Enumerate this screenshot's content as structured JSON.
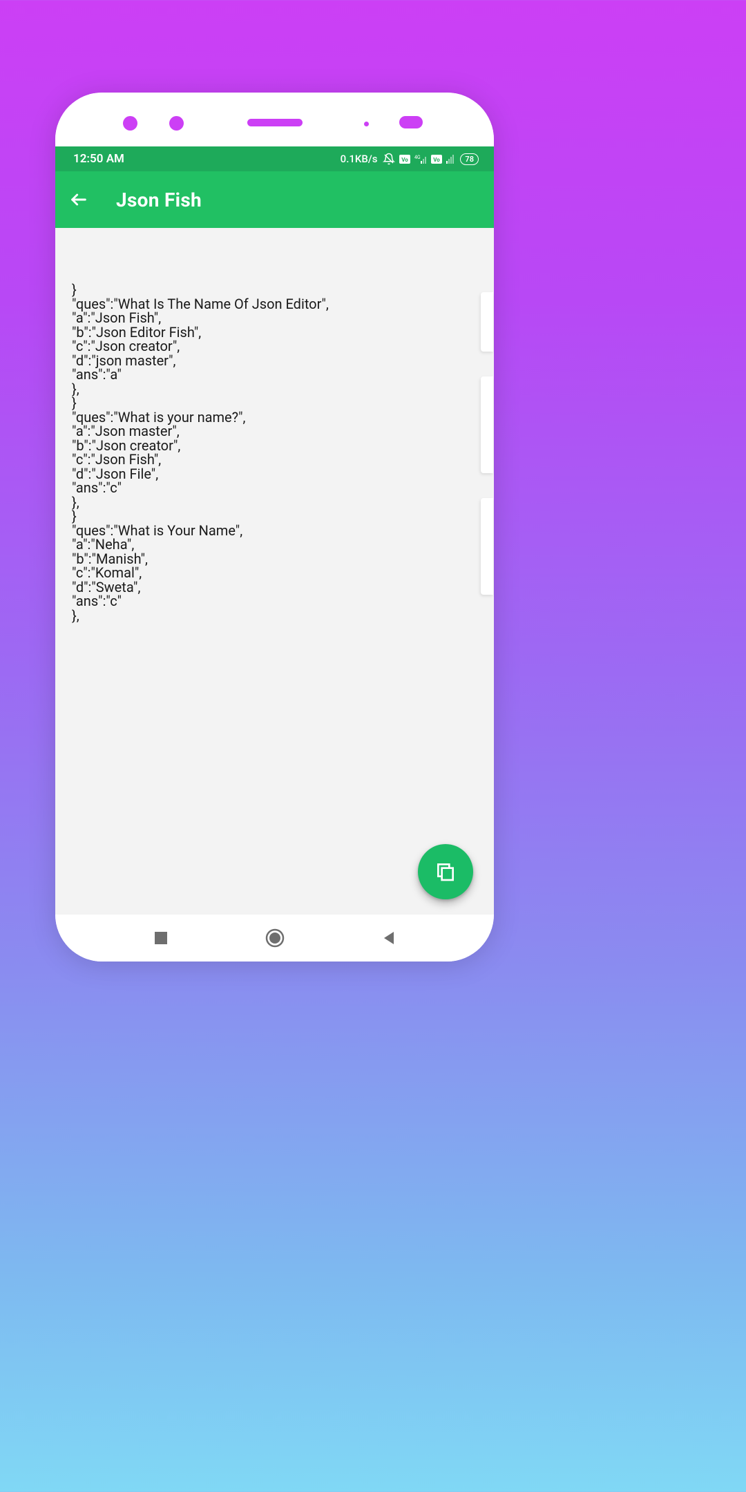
{
  "statusbar": {
    "time": "12:50 AM",
    "speed": "0.1KB/s",
    "battery": "78"
  },
  "appbar": {
    "title": "Json Fish"
  },
  "content": {
    "text": "}\n\"ques\":\"What Is The Name Of Json Editor\",\n\"a\":\"Json Fish\",\n\"b\":\"Json Editor Fish\",\n\"c\":\"Json creator\",\n\"d\":\"json master\",\n\"ans\":\"a\"\n},\n}\n\"ques\":\"What is your name?\",\n\"a\":\"Json master\",\n\"b\":\"Json creator\",\n\"c\":\"Json Fish\",\n\"d\":\"Json File\",\n\"ans\":\"c\"\n},\n}\n\"ques\":\"What is Your Name\",\n\"a\":\"Neha\",\n\"b\":\"Manish\",\n\"c\":\"Komal\",\n\"d\":\"Sweta\",\n\"ans\":\"c\"\n},"
  }
}
